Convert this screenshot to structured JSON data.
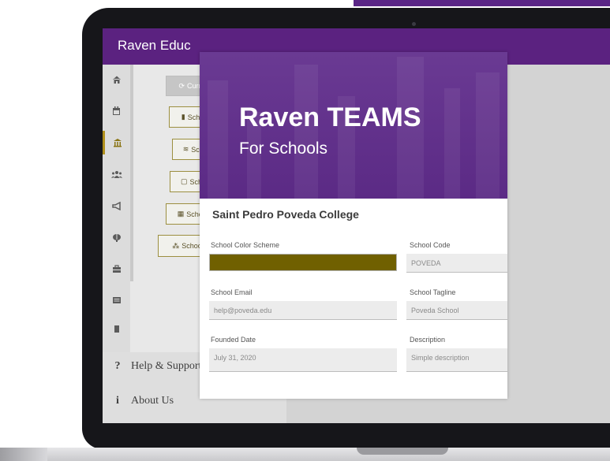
{
  "app": {
    "title": "Raven Educ"
  },
  "rail_icons": [
    "home-icon",
    "calendar-icon",
    "school-icon",
    "users-icon",
    "megaphone-icon",
    "brain-icon",
    "briefcase-icon",
    "card-icon",
    "more-icon"
  ],
  "submenu": {
    "currently_default": "Currently Default",
    "buildings": "School Buildings",
    "floors": "School Floors",
    "rooms": "School Rooms",
    "facilities": "School Facilities",
    "departments": "School Departments"
  },
  "bottom_menu": {
    "help_icon": "?",
    "help": "Help & Support",
    "about_icon": "i",
    "about": "About Us"
  },
  "hero": {
    "title": "Raven TEAMS",
    "subtitle": "For Schools"
  },
  "school": {
    "name": "Saint Pedro Poveda College",
    "color_scheme_label": "School Color Scheme",
    "color_scheme_value": "#706000",
    "code_label": "School Code",
    "code_value": "POVEDA",
    "email_label": "School Email",
    "email_value": "help@poveda.edu",
    "tagline_label": "School Tagline",
    "tagline_value": "Poveda School",
    "founded_label": "Founded Date",
    "founded_value": "July 31, 2020",
    "description_label": "Description",
    "description_value": "Simple description"
  },
  "colors": {
    "brand_purple": "#5b2280",
    "accent_gold": "#b0901b"
  }
}
